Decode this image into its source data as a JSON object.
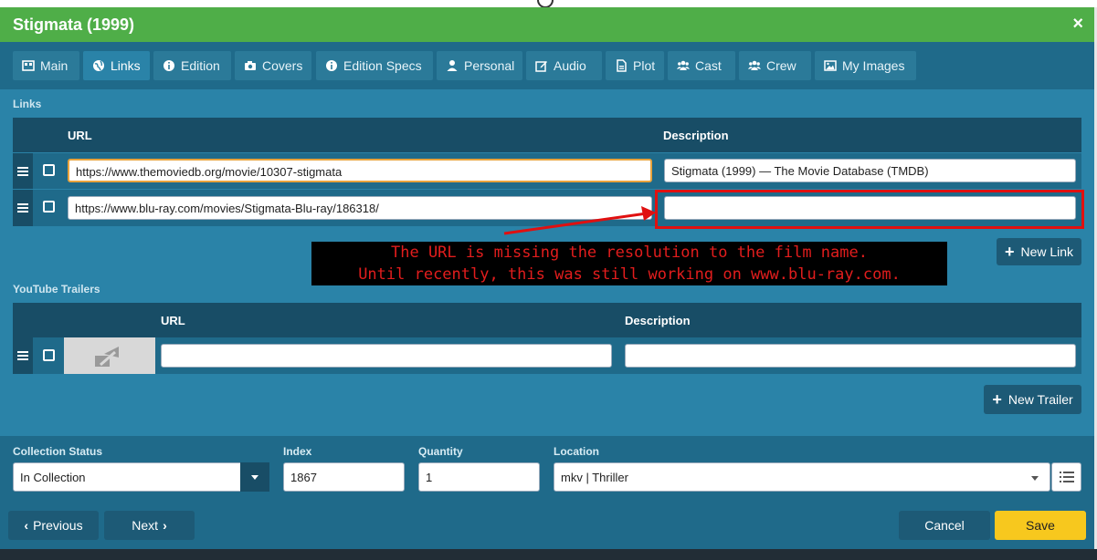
{
  "window": {
    "title": "Stigmata (1999)",
    "close_glyph": "×"
  },
  "tabs": [
    {
      "label": "Main",
      "icon": "film-icon"
    },
    {
      "label": "Links",
      "icon": "globe-icon",
      "active": true
    },
    {
      "label": "Edition",
      "icon": "info-icon"
    },
    {
      "label": "Covers",
      "icon": "camera-icon"
    },
    {
      "label": "Edition Specs",
      "icon": "info-icon"
    },
    {
      "label": "Personal",
      "icon": "user-icon"
    },
    {
      "label": "Audio",
      "icon": "edit-icon"
    },
    {
      "label": "Plot",
      "icon": "document-icon"
    },
    {
      "label": "Cast",
      "icon": "users-icon"
    },
    {
      "label": "Crew",
      "icon": "users-icon"
    },
    {
      "label": "My Images",
      "icon": "image-icon"
    }
  ],
  "links": {
    "section_label": "Links",
    "col_url": "URL",
    "col_description": "Description",
    "rows": [
      {
        "url": "https://www.themoviedb.org/movie/10307-stigmata",
        "description": "Stigmata (1999) — The Movie Database (TMDB)"
      },
      {
        "url": "https://www.blu-ray.com/movies/Stigmata-Blu-ray/186318/",
        "description": ""
      }
    ],
    "new_link_label": "New Link"
  },
  "annotation": {
    "line1": "The URL is missing the resolution to the film name.",
    "line2": "Until recently, this was still working on www.blu-ray.com.",
    "color": "#e21d1d"
  },
  "trailers": {
    "section_label": "YouTube Trailers",
    "col_url": "URL",
    "col_description": "Description",
    "rows": [
      {
        "url": "",
        "description": ""
      }
    ],
    "new_trailer_label": "New Trailer"
  },
  "footer": {
    "collection_status_label": "Collection Status",
    "collection_status_value": "In Collection",
    "index_label": "Index",
    "index_value": "1867",
    "quantity_label": "Quantity",
    "quantity_value": "1",
    "location_label": "Location",
    "location_value": "mkv | Thriller"
  },
  "buttons": {
    "previous": "Previous",
    "next": "Next",
    "cancel": "Cancel",
    "save": "Save"
  },
  "colors": {
    "titlebar": "#4fae48",
    "dialog": "#2a83a8",
    "save": "#f7c81e"
  }
}
